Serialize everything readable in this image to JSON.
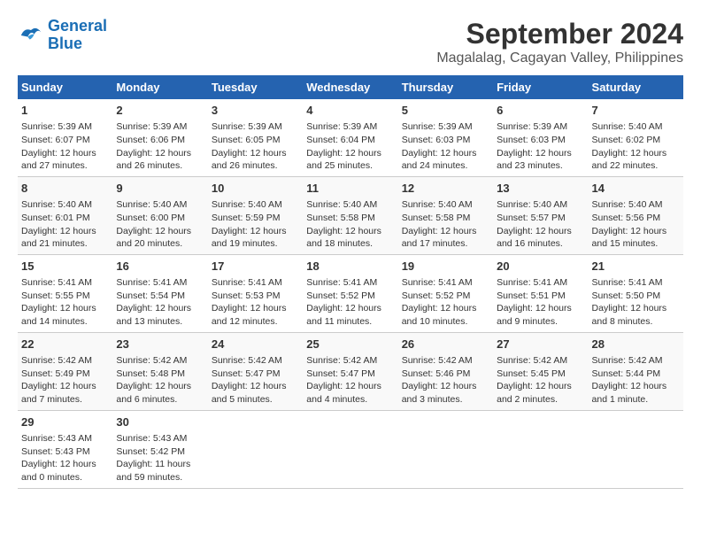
{
  "logo": {
    "line1": "General",
    "line2": "Blue"
  },
  "title": "September 2024",
  "location": "Magalalag, Cagayan Valley, Philippines",
  "headers": [
    "Sunday",
    "Monday",
    "Tuesday",
    "Wednesday",
    "Thursday",
    "Friday",
    "Saturday"
  ],
  "weeks": [
    [
      {
        "day": "1",
        "sunrise": "Sunrise: 5:39 AM",
        "sunset": "Sunset: 6:07 PM",
        "daylight": "Daylight: 12 hours and 27 minutes."
      },
      {
        "day": "2",
        "sunrise": "Sunrise: 5:39 AM",
        "sunset": "Sunset: 6:06 PM",
        "daylight": "Daylight: 12 hours and 26 minutes."
      },
      {
        "day": "3",
        "sunrise": "Sunrise: 5:39 AM",
        "sunset": "Sunset: 6:05 PM",
        "daylight": "Daylight: 12 hours and 26 minutes."
      },
      {
        "day": "4",
        "sunrise": "Sunrise: 5:39 AM",
        "sunset": "Sunset: 6:04 PM",
        "daylight": "Daylight: 12 hours and 25 minutes."
      },
      {
        "day": "5",
        "sunrise": "Sunrise: 5:39 AM",
        "sunset": "Sunset: 6:03 PM",
        "daylight": "Daylight: 12 hours and 24 minutes."
      },
      {
        "day": "6",
        "sunrise": "Sunrise: 5:39 AM",
        "sunset": "Sunset: 6:03 PM",
        "daylight": "Daylight: 12 hours and 23 minutes."
      },
      {
        "day": "7",
        "sunrise": "Sunrise: 5:40 AM",
        "sunset": "Sunset: 6:02 PM",
        "daylight": "Daylight: 12 hours and 22 minutes."
      }
    ],
    [
      {
        "day": "8",
        "sunrise": "Sunrise: 5:40 AM",
        "sunset": "Sunset: 6:01 PM",
        "daylight": "Daylight: 12 hours and 21 minutes."
      },
      {
        "day": "9",
        "sunrise": "Sunrise: 5:40 AM",
        "sunset": "Sunset: 6:00 PM",
        "daylight": "Daylight: 12 hours and 20 minutes."
      },
      {
        "day": "10",
        "sunrise": "Sunrise: 5:40 AM",
        "sunset": "Sunset: 5:59 PM",
        "daylight": "Daylight: 12 hours and 19 minutes."
      },
      {
        "day": "11",
        "sunrise": "Sunrise: 5:40 AM",
        "sunset": "Sunset: 5:58 PM",
        "daylight": "Daylight: 12 hours and 18 minutes."
      },
      {
        "day": "12",
        "sunrise": "Sunrise: 5:40 AM",
        "sunset": "Sunset: 5:58 PM",
        "daylight": "Daylight: 12 hours and 17 minutes."
      },
      {
        "day": "13",
        "sunrise": "Sunrise: 5:40 AM",
        "sunset": "Sunset: 5:57 PM",
        "daylight": "Daylight: 12 hours and 16 minutes."
      },
      {
        "day": "14",
        "sunrise": "Sunrise: 5:40 AM",
        "sunset": "Sunset: 5:56 PM",
        "daylight": "Daylight: 12 hours and 15 minutes."
      }
    ],
    [
      {
        "day": "15",
        "sunrise": "Sunrise: 5:41 AM",
        "sunset": "Sunset: 5:55 PM",
        "daylight": "Daylight: 12 hours and 14 minutes."
      },
      {
        "day": "16",
        "sunrise": "Sunrise: 5:41 AM",
        "sunset": "Sunset: 5:54 PM",
        "daylight": "Daylight: 12 hours and 13 minutes."
      },
      {
        "day": "17",
        "sunrise": "Sunrise: 5:41 AM",
        "sunset": "Sunset: 5:53 PM",
        "daylight": "Daylight: 12 hours and 12 minutes."
      },
      {
        "day": "18",
        "sunrise": "Sunrise: 5:41 AM",
        "sunset": "Sunset: 5:52 PM",
        "daylight": "Daylight: 12 hours and 11 minutes."
      },
      {
        "day": "19",
        "sunrise": "Sunrise: 5:41 AM",
        "sunset": "Sunset: 5:52 PM",
        "daylight": "Daylight: 12 hours and 10 minutes."
      },
      {
        "day": "20",
        "sunrise": "Sunrise: 5:41 AM",
        "sunset": "Sunset: 5:51 PM",
        "daylight": "Daylight: 12 hours and 9 minutes."
      },
      {
        "day": "21",
        "sunrise": "Sunrise: 5:41 AM",
        "sunset": "Sunset: 5:50 PM",
        "daylight": "Daylight: 12 hours and 8 minutes."
      }
    ],
    [
      {
        "day": "22",
        "sunrise": "Sunrise: 5:42 AM",
        "sunset": "Sunset: 5:49 PM",
        "daylight": "Daylight: 12 hours and 7 minutes."
      },
      {
        "day": "23",
        "sunrise": "Sunrise: 5:42 AM",
        "sunset": "Sunset: 5:48 PM",
        "daylight": "Daylight: 12 hours and 6 minutes."
      },
      {
        "day": "24",
        "sunrise": "Sunrise: 5:42 AM",
        "sunset": "Sunset: 5:47 PM",
        "daylight": "Daylight: 12 hours and 5 minutes."
      },
      {
        "day": "25",
        "sunrise": "Sunrise: 5:42 AM",
        "sunset": "Sunset: 5:47 PM",
        "daylight": "Daylight: 12 hours and 4 minutes."
      },
      {
        "day": "26",
        "sunrise": "Sunrise: 5:42 AM",
        "sunset": "Sunset: 5:46 PM",
        "daylight": "Daylight: 12 hours and 3 minutes."
      },
      {
        "day": "27",
        "sunrise": "Sunrise: 5:42 AM",
        "sunset": "Sunset: 5:45 PM",
        "daylight": "Daylight: 12 hours and 2 minutes."
      },
      {
        "day": "28",
        "sunrise": "Sunrise: 5:42 AM",
        "sunset": "Sunset: 5:44 PM",
        "daylight": "Daylight: 12 hours and 1 minute."
      }
    ],
    [
      {
        "day": "29",
        "sunrise": "Sunrise: 5:43 AM",
        "sunset": "Sunset: 5:43 PM",
        "daylight": "Daylight: 12 hours and 0 minutes."
      },
      {
        "day": "30",
        "sunrise": "Sunrise: 5:43 AM",
        "sunset": "Sunset: 5:42 PM",
        "daylight": "Daylight: 11 hours and 59 minutes."
      },
      {
        "day": "",
        "sunrise": "",
        "sunset": "",
        "daylight": ""
      },
      {
        "day": "",
        "sunrise": "",
        "sunset": "",
        "daylight": ""
      },
      {
        "day": "",
        "sunrise": "",
        "sunset": "",
        "daylight": ""
      },
      {
        "day": "",
        "sunrise": "",
        "sunset": "",
        "daylight": ""
      },
      {
        "day": "",
        "sunrise": "",
        "sunset": "",
        "daylight": ""
      }
    ]
  ]
}
